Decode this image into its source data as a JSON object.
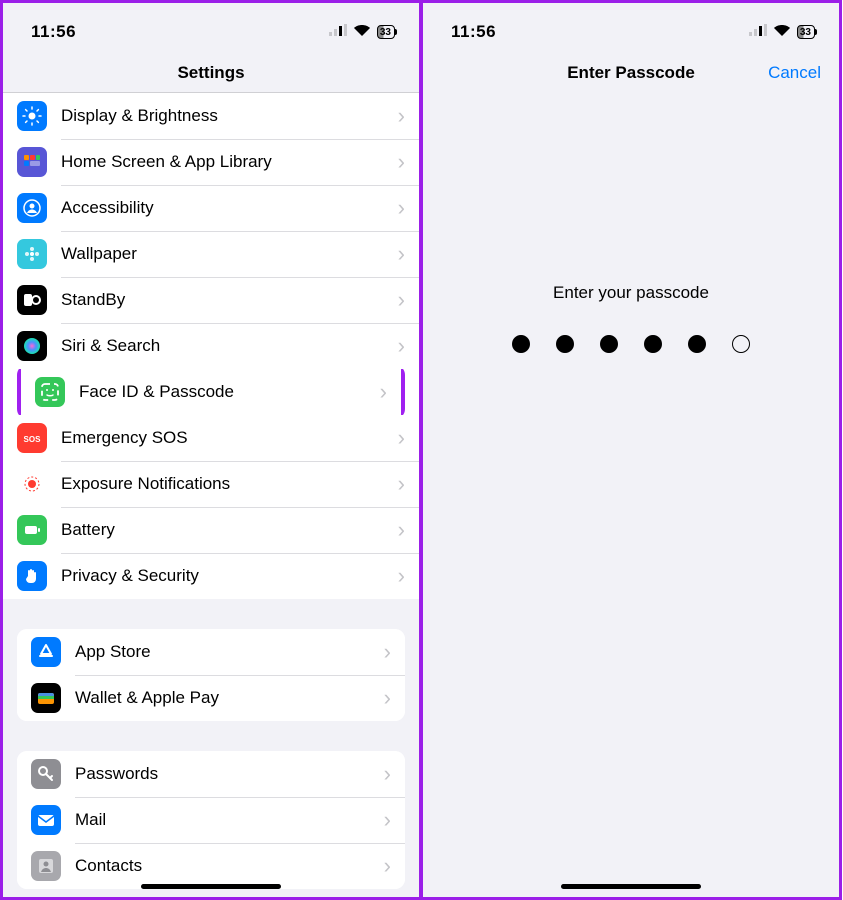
{
  "status": {
    "time": "11:56",
    "battery": "33"
  },
  "left": {
    "title": "Settings",
    "groups": [
      {
        "inset": false,
        "rows": [
          {
            "label": "Display & Brightness",
            "name": "display-brightness",
            "icon": "sun-icon",
            "bg": "#007aff"
          },
          {
            "label": "Home Screen & App Library",
            "name": "home-screen",
            "icon": "grid-icon",
            "bg": "#5856d6"
          },
          {
            "label": "Accessibility",
            "name": "accessibility",
            "icon": "person-icon",
            "bg": "#007aff"
          },
          {
            "label": "Wallpaper",
            "name": "wallpaper",
            "icon": "flower-icon",
            "bg": "#34c8de"
          },
          {
            "label": "StandBy",
            "name": "standby",
            "icon": "clock-icon",
            "bg": "#000000"
          },
          {
            "label": "Siri & Search",
            "name": "siri-search",
            "icon": "siri-icon",
            "bg": "#000000"
          },
          {
            "label": "Face ID & Passcode",
            "name": "face-id-passcode",
            "icon": "face-icon",
            "bg": "#34c759",
            "highlight": true
          },
          {
            "label": "Emergency SOS",
            "name": "emergency-sos",
            "icon": "sos-icon",
            "bg": "#ff3b30"
          },
          {
            "label": "Exposure Notifications",
            "name": "exposure-notifications",
            "icon": "exposure-icon",
            "bg": "#ffffff"
          },
          {
            "label": "Battery",
            "name": "battery",
            "icon": "battery-icon",
            "bg": "#34c759"
          },
          {
            "label": "Privacy & Security",
            "name": "privacy-security",
            "icon": "hand-icon",
            "bg": "#007aff"
          }
        ]
      },
      {
        "inset": true,
        "rows": [
          {
            "label": "App Store",
            "name": "app-store",
            "icon": "appstore-icon",
            "bg": "#007aff"
          },
          {
            "label": "Wallet & Apple Pay",
            "name": "wallet",
            "icon": "wallet-icon",
            "bg": "#000000"
          }
        ]
      },
      {
        "inset": true,
        "rows": [
          {
            "label": "Passwords",
            "name": "passwords",
            "icon": "key-icon",
            "bg": "#8e8e93"
          },
          {
            "label": "Mail",
            "name": "mail",
            "icon": "mail-icon",
            "bg": "#007aff"
          },
          {
            "label": "Contacts",
            "name": "contacts",
            "icon": "contacts-icon",
            "bg": "#a8a8ad"
          }
        ]
      }
    ]
  },
  "right": {
    "title": "Enter Passcode",
    "cancel": "Cancel",
    "prompt": "Enter your passcode",
    "dots_total": 6,
    "dots_filled": 5
  },
  "icons": {
    "sun-icon": "<circle cx='10' cy='10' r='3.5'/><g stroke='#fff' stroke-width='1.5' stroke-linecap='round'><line x1='10' y1='1' x2='10' y2='3'/><line x1='10' y1='17' x2='10' y2='19'/><line x1='1' y1='10' x2='3' y2='10'/><line x1='17' y1='10' x2='19' y2='10'/><line x1='3.6' y1='3.6' x2='5' y2='5'/><line x1='15' y1='15' x2='16.4' y2='16.4'/><line x1='3.6' y1='16.4' x2='5' y2='15'/><line x1='15' y1='5' x2='16.4' y2='3.6'/></g>",
    "grid-icon": "<rect x='2' y='3' width='5' height='5' rx='1' fill='#ff9100'/><rect x='8' y='3' width='5' height='5' rx='1' fill='#ff3b30'/><rect x='14' y='3' width='4' height='5' rx='1' fill='#34c759'/><rect x='2' y='9' width='5' height='5' rx='1' fill='#007aff'/><rect x='8' y='9' width='10' height='5' rx='1' fill='#ffffff' opacity='0.4'/>",
    "person-icon": "<circle cx='10' cy='10' r='8' fill='none' stroke='#fff' stroke-width='1.5'/><circle cx='10' cy='8' r='2.5'/><path d='M5 15c1-2.5 3-3.5 5-3.5s4 1 5 3.5z'/>",
    "flower-icon": "<circle cx='10' cy='10' r='2' fill='#fff'/><circle cx='10' cy='5' r='2' fill='#fff' opacity='0.85'/><circle cx='10' cy='15' r='2' fill='#fff' opacity='0.85'/><circle cx='5' cy='10' r='2' fill='#fff' opacity='0.85'/><circle cx='15' cy='10' r='2' fill='#fff' opacity='0.85'/>",
    "clock-icon": "<rect x='2' y='4' width='8' height='12' rx='2' fill='#fff'/><circle cx='14' cy='10' r='5' fill='#fff'/><circle cx='14' cy='10' r='3' fill='#000'/>",
    "siri-icon": "<circle cx='10' cy='10' r='8' fill='url(#sg)'/><defs><radialGradient id='sg'><stop offset='0' stop-color='#ff6ad5'/><stop offset='0.5' stop-color='#4a90ff'/><stop offset='1' stop-color='#19e3b1'/></radialGradient></defs>",
    "face-icon": "<rect x='2' y='2' width='16' height='16' rx='3' fill='none' stroke='#fff' stroke-width='1.8' stroke-dasharray='5 4'/><circle cx='7' cy='8' r='1'/><circle cx='13' cy='8' r='1'/><path d='M7 13c1 1 5 1 6 0' stroke='#fff' stroke-width='1.5' fill='none' stroke-linecap='round'/>",
    "sos-icon": "<text x='10' y='14' text-anchor='middle' font-size='8' font-weight='700' fill='#fff'>SOS</text>",
    "exposure-icon": "<circle cx='10' cy='10' r='4' fill='#ff3b30'/><circle cx='10' cy='10' r='7' fill='none' stroke='#ff3b30' stroke-width='1' stroke-dasharray='2 2'/>",
    "battery-icon": "<rect x='3' y='6' width='12' height='8' rx='2' fill='#fff'/><rect x='16' y='8' width='2' height='4' rx='1' fill='#fff'/>",
    "hand-icon": "<path d='M6 10V5a1 1 0 012 0v4V4a1 1 0 012 0v5V5a1 1 0 012 0v5V7a1 1 0 012 0v6a4 4 0 01-4 4h-2a4 4 0 01-4-4z' fill='#fff'/>",
    "appstore-icon": "<path d='M10 3l-5 9h10z' fill='none' stroke='#fff' stroke-width='2' stroke-linecap='round' stroke-linejoin='round'/><line x1='4' y1='14' x2='16' y2='14' stroke='#fff' stroke-width='2' stroke-linecap='round'/>",
    "wallet-icon": "<rect x='2' y='5' width='16' height='11' rx='2' fill='#fc9403'/><rect x='2' y='5' width='16' height='4' rx='2' fill='#4a90e2'/><rect x='2' y='8' width='16' height='3' fill='#34c759'/>",
    "key-icon": "<circle cx='7' cy='7' r='4' fill='none' stroke='#fff' stroke-width='2'/><line x1='10' y1='10' x2='16' y2='16' stroke='#fff' stroke-width='2' stroke-linecap='round'/><line x1='14' y1='14' x2='16' y2='12' stroke='#fff' stroke-width='2' stroke-linecap='round'/>",
    "mail-icon": "<rect x='2' y='5' width='16' height='11' rx='2' fill='#fff'/><path d='M2 6l8 6 8-6' stroke='#007aff' stroke-width='1.5' fill='none'/>",
    "contacts-icon": "<rect x='3' y='3' width='14' height='14' rx='2' fill='#d8d8db'/><circle cx='10' cy='8' r='2.5' fill='#8e8e93'/><path d='M5 16c1-3 3-4 5-4s4 1 5 4z' fill='#8e8e93'/>"
  }
}
